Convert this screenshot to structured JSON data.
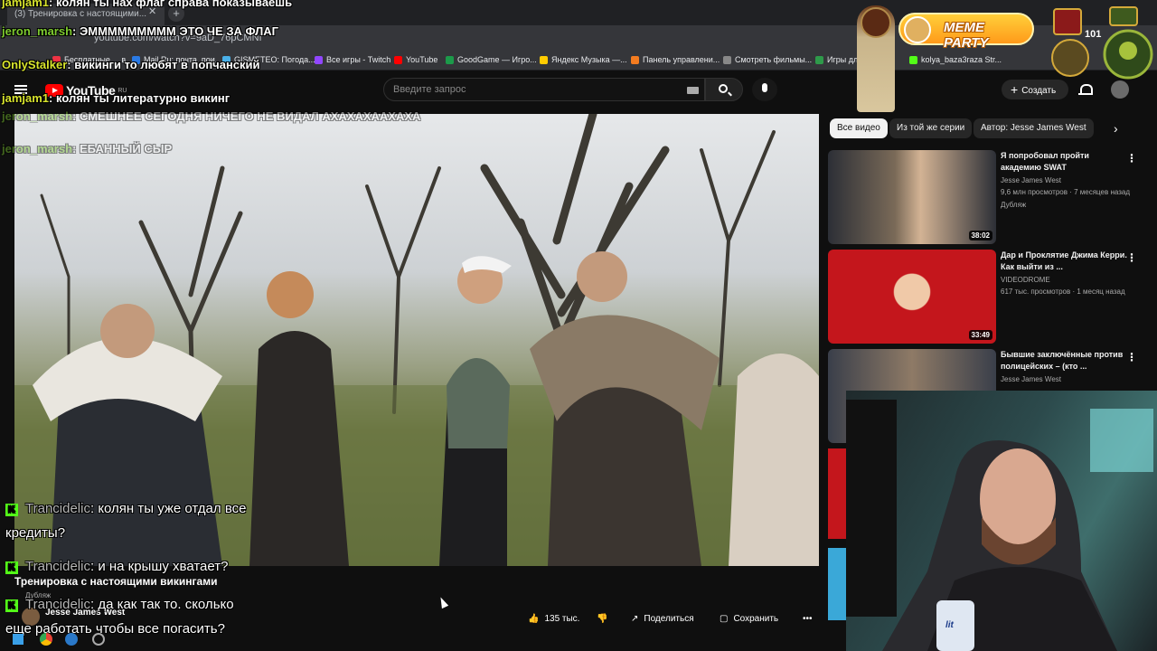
{
  "browser": {
    "tab_title": "(3) Тренировка с настоящими...",
    "url": "youtube.com/watch?v=9aD_76pCMNI",
    "bookmarks": [
      {
        "label": "Бесплатные ... в..."
      },
      {
        "label": "Mail.Ru: почта, пои..."
      },
      {
        "label": "GISMETEO: Погода..."
      },
      {
        "label": "Все игры - Twitch"
      },
      {
        "label": "YouTube"
      },
      {
        "label": "GoodGame — Игро..."
      },
      {
        "label": "Яндекс Музыка —..."
      },
      {
        "label": "Панель управлени..."
      },
      {
        "label": "Смотреть фильмы..."
      },
      {
        "label": "Игры для..."
      },
      {
        "label": "kolya_baza3raza Str..."
      }
    ]
  },
  "youtube": {
    "logo": "YouTube",
    "logo_region": "RU",
    "search_placeholder": "Введите запрос",
    "create_label": "Создать"
  },
  "video": {
    "title": "Тренировка с настоящими викингами",
    "dub_label": "Дубляж",
    "channel": "Jesse James West",
    "likes": "135 тыс.",
    "share": "Поделиться",
    "save": "Сохранить"
  },
  "chips": [
    "Все видео",
    "Из той же серии",
    "Автор: Jesse James West"
  ],
  "recommendations": [
    {
      "title": "Я попробовал пройти академию SWAT",
      "channel": "Jesse James West",
      "meta": "9,6 млн просмотров · 7 месяцев назад",
      "badge": "Дубляж",
      "duration": "38:02"
    },
    {
      "title": "Дар и Проклятие Джима Керри. Как выйти из ...",
      "channel": "VIDEODROME",
      "meta": "617 тыс. просмотров · 1 месяц назад",
      "badge": "",
      "duration": "33:49"
    },
    {
      "title": "Бывшие заключённые против полицейских – (кто ...",
      "channel": "Jesse James West",
      "meta": "",
      "badge": "",
      "duration": ""
    }
  ],
  "chat_top": [
    {
      "user": "jamjam1",
      "text": "колян ты нах флаг справа показываешь",
      "user_color": "#d8e42d"
    },
    {
      "user": "jeron_marsh",
      "text": "ЭМММММММММ ЭТО ЧЕ ЗА ФЛАГ",
      "user_color": "#7ecb2f"
    },
    {
      "user": "OnlyStalker",
      "text": "викинги то любят в попчанский",
      "user_color": "#d8e42d"
    },
    {
      "user": "jamjam1",
      "text": "колян ты литературно викинг",
      "user_color": "#d8e42d"
    },
    {
      "user": "jeron_marsh",
      "text": "СМЕШНЕЕ СЕГОДНЯ НИЧЕГО НЕ ВИДАЛ АХАХАХААХАХА",
      "user_color": "#7ecb2f"
    },
    {
      "user": "jeron_marsh",
      "text": "ЕБАННЫЙ СЫР",
      "user_color": "#7ecb2f"
    }
  ],
  "chat_bottom": [
    {
      "user": "Trancidelic",
      "text": "колян ты уже отдал все",
      "cont": "кредиты?"
    },
    {
      "user": "Trancidelic",
      "text": "и на крышу хватает?",
      "cont": ""
    },
    {
      "user": "Trancidelic",
      "text": "да как так то. сколько",
      "cont": "еще работать чтобы все погасить?"
    }
  ],
  "overlay": {
    "meme_banner": "MEME PARTY",
    "rank_number": "101"
  },
  "colors": {
    "yt_red": "#ff0000",
    "kick_green": "#53fc18",
    "meme_orange": "#ff9a1a"
  }
}
